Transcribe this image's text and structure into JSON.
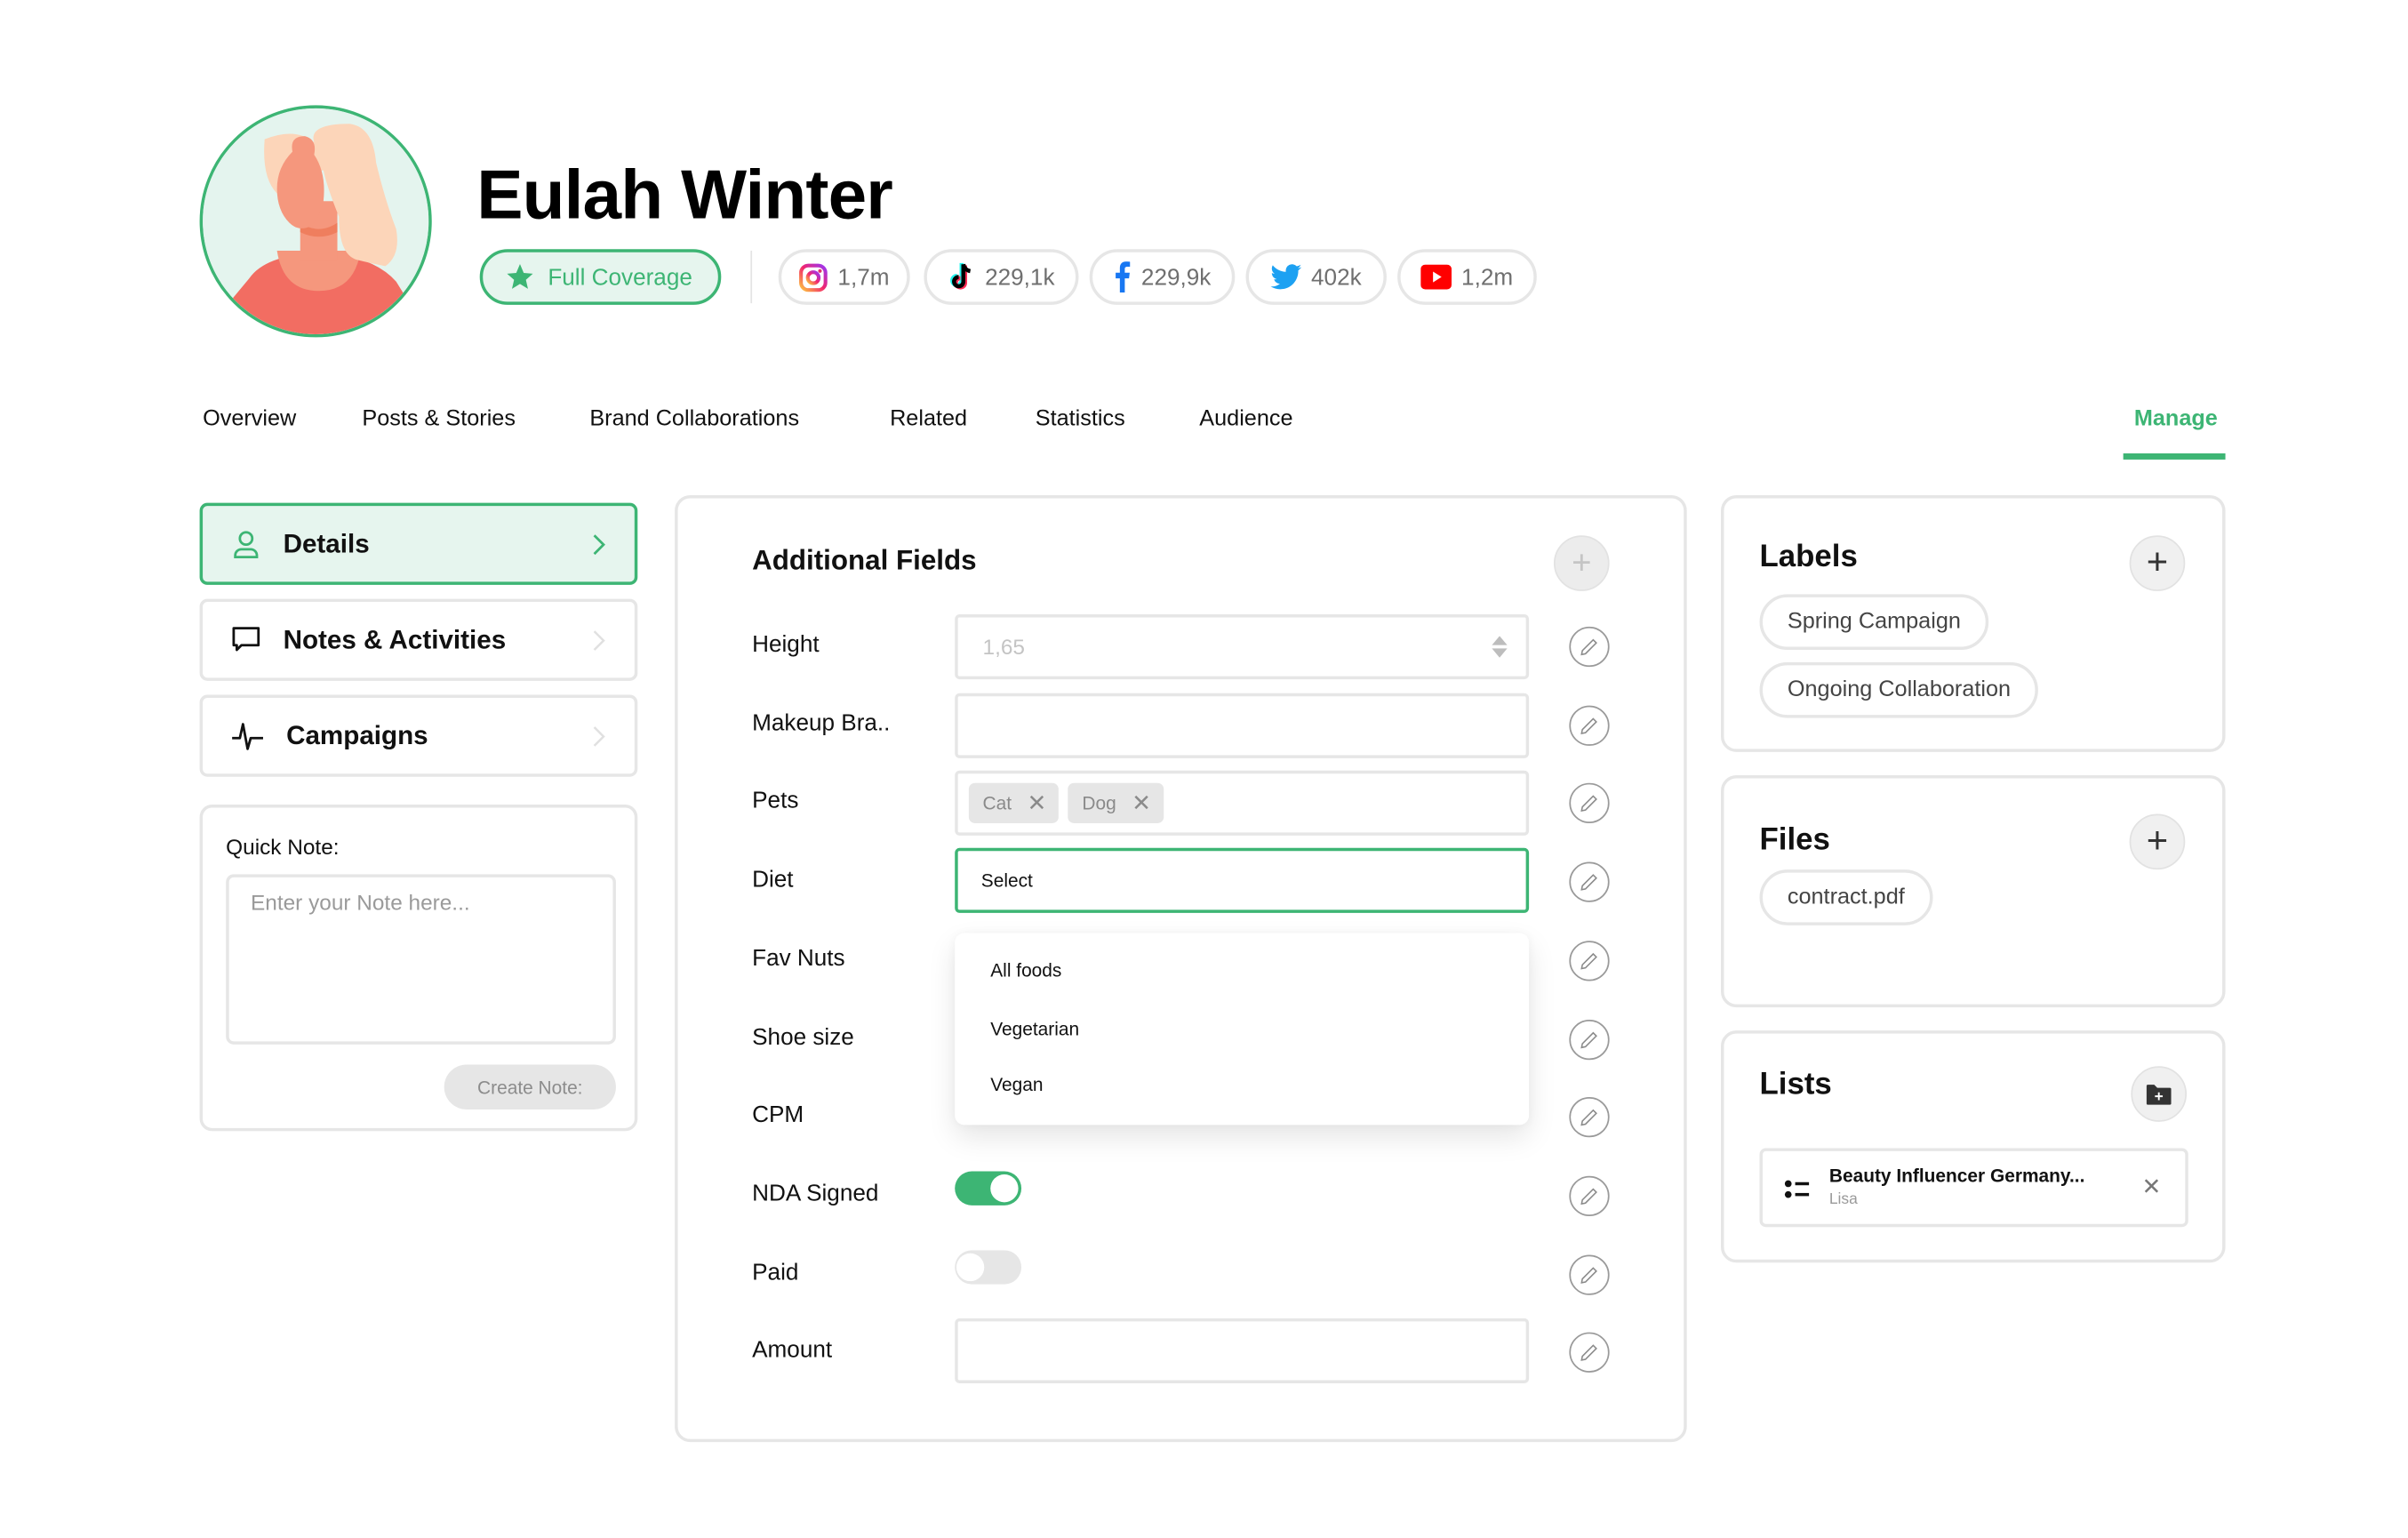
{
  "profile": {
    "name": "Eulah Winter",
    "coverage_badge": "Full Coverage",
    "socials": [
      {
        "platform": "instagram",
        "icon": "instagram-icon",
        "count": "1,7m"
      },
      {
        "platform": "tiktok",
        "icon": "tiktok-icon",
        "count": "229,1k"
      },
      {
        "platform": "facebook",
        "icon": "facebook-icon",
        "count": "229,9k"
      },
      {
        "platform": "twitter",
        "icon": "twitter-icon",
        "count": "402k"
      },
      {
        "platform": "youtube",
        "icon": "youtube-icon",
        "count": "1,2m"
      }
    ]
  },
  "tabs": [
    {
      "label": "Overview",
      "active": false
    },
    {
      "label": "Posts & Stories",
      "active": false
    },
    {
      "label": "Brand Collaborations",
      "active": false
    },
    {
      "label": "Related",
      "active": false
    },
    {
      "label": "Statistics",
      "active": false
    },
    {
      "label": "Audience",
      "active": false
    },
    {
      "label": "Manage",
      "active": true
    }
  ],
  "sidebar": {
    "items": [
      {
        "label": "Details",
        "icon": "user-icon",
        "active": true
      },
      {
        "label": "Notes & Activities",
        "icon": "chat-bubble-icon",
        "active": false
      },
      {
        "label": "Campaigns",
        "icon": "pulse-icon",
        "active": false
      }
    ],
    "quick_note": {
      "label": "Quick Note:",
      "placeholder": "Enter your Note here...",
      "button": "Create Note:"
    }
  },
  "additional_fields": {
    "title": "Additional Fields",
    "fields": [
      {
        "label": "Height",
        "type": "number",
        "value": "",
        "placeholder": "1,65"
      },
      {
        "label": "Makeup Bra..",
        "type": "text",
        "value": ""
      },
      {
        "label": "Pets",
        "type": "tags",
        "tags": [
          "Cat",
          "Dog"
        ]
      },
      {
        "label": "Diet",
        "type": "select",
        "value": "Select",
        "open": true,
        "options": [
          "All foods",
          "Vegetarian",
          "Vegan"
        ]
      },
      {
        "label": "Fav Nuts",
        "type": "text",
        "value": ""
      },
      {
        "label": "Shoe size",
        "type": "text",
        "value": ""
      },
      {
        "label": "CPM",
        "type": "text",
        "value": ""
      },
      {
        "label": "NDA Signed",
        "type": "toggle",
        "value": true
      },
      {
        "label": "Paid",
        "type": "toggle",
        "value": false
      },
      {
        "label": "Amount",
        "type": "text",
        "value": ""
      }
    ]
  },
  "labels": {
    "title": "Labels",
    "items": [
      "Spring Campaign",
      "Ongoing Collaboration"
    ]
  },
  "files": {
    "title": "Files",
    "items": [
      "contract.pdf"
    ]
  },
  "lists": {
    "title": "Lists",
    "items": [
      {
        "name": "Beauty Influencer Germany...",
        "owner": "Lisa"
      }
    ]
  },
  "colors": {
    "accent": "#3db574",
    "accent_bg": "#e6f5ee",
    "border": "#e6e6e6",
    "avatar_shirt": "#f26d62",
    "avatar_skin": "#f5977d",
    "avatar_hair": "#fcd5b9"
  }
}
